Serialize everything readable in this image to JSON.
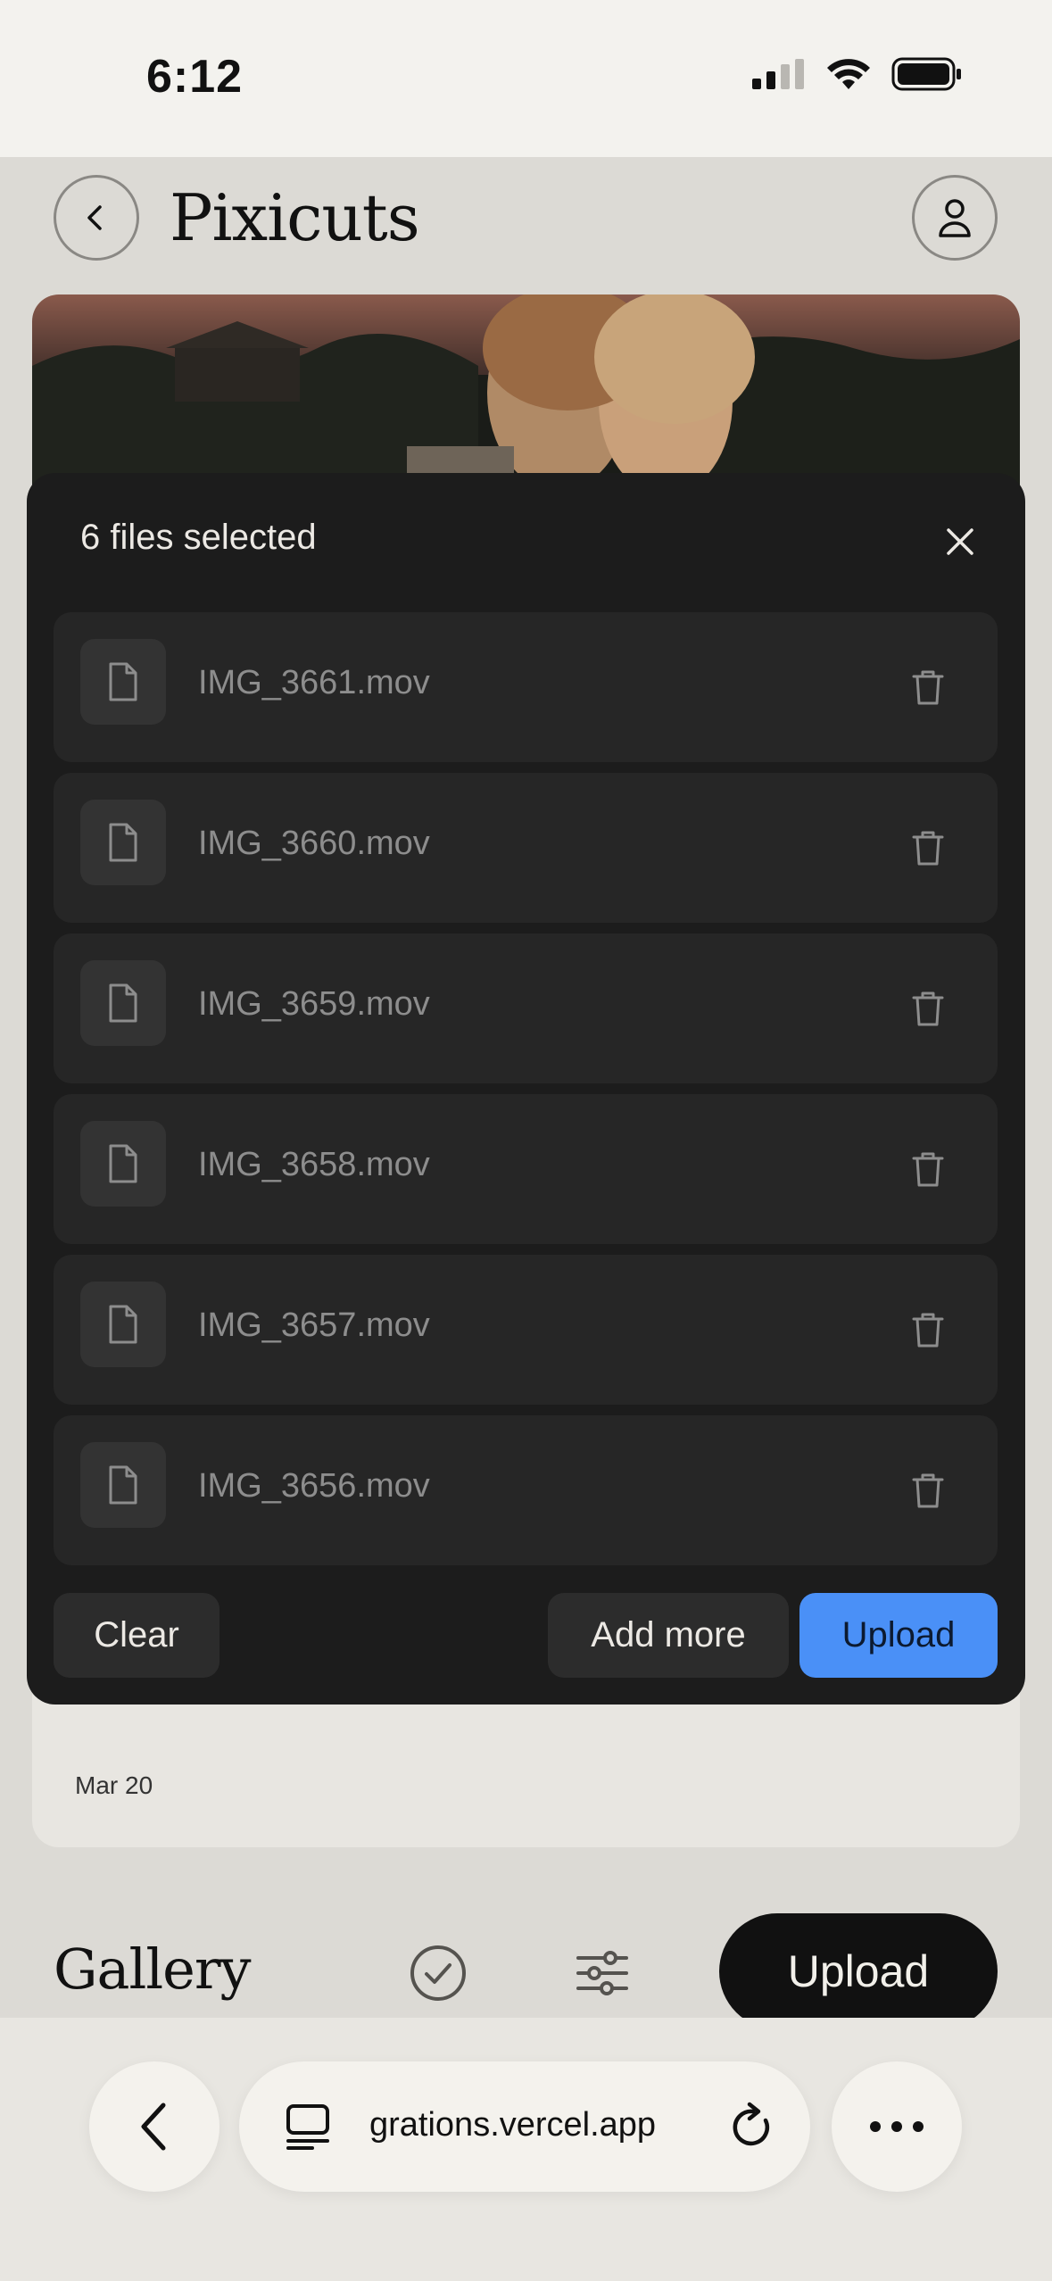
{
  "status_bar": {
    "time": "6:12"
  },
  "header": {
    "title": "Pixicuts"
  },
  "card": {
    "date": "Mar 20"
  },
  "gallery": {
    "title": "Gallery",
    "upload_label": "Upload"
  },
  "modal": {
    "title": "6 files selected",
    "files": [
      {
        "name": "IMG_3661.mov"
      },
      {
        "name": "IMG_3660.mov"
      },
      {
        "name": "IMG_3659.mov"
      },
      {
        "name": "IMG_3658.mov"
      },
      {
        "name": "IMG_3657.mov"
      },
      {
        "name": "IMG_3656.mov"
      }
    ],
    "clear_label": "Clear",
    "add_more_label": "Add more",
    "upload_label": "Upload",
    "upload_color": "#4a90f7"
  },
  "browser": {
    "url": "grations.vercel.app"
  }
}
